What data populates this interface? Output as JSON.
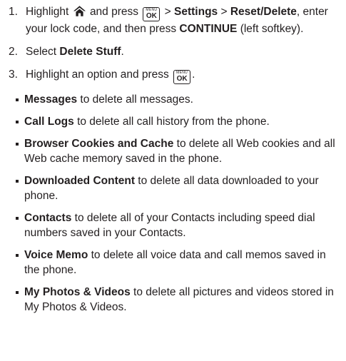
{
  "steps": [
    {
      "num": "1.",
      "p1": "Highlight",
      "p2": "and press",
      "p3": ">",
      "settings": "Settings",
      "p4": ">",
      "reset": "Reset/Delete",
      "p5": ", enter your lock code, and then press",
      "cont": "CONTINUE",
      "p6": "(left softkey)."
    },
    {
      "num": "2.",
      "p1": "Select",
      "bold": "Delete Stuff",
      "p2": "."
    },
    {
      "num": "3.",
      "p1": "Highlight an option and press",
      "p2": "."
    }
  ],
  "icons": {
    "home": "home-icon",
    "menuok_top": "MENU",
    "menuok_bottom": "OK"
  },
  "options": [
    {
      "bold": "Messages",
      "text": " to delete all messages."
    },
    {
      "bold": "Call Logs",
      "text": " to delete all call history from the phone."
    },
    {
      "bold": "Browser Cookies and Cache",
      "text": " to delete all Web cookies and all Web cache memory saved in the phone."
    },
    {
      "bold": "Downloaded Content",
      "text": " to delete all data downloaded to your phone."
    },
    {
      "bold": "Contacts",
      "text": " to delete all of your Contacts including speed dial numbers saved in your Contacts."
    },
    {
      "bold": "Voice Memo",
      "text": " to delete all voice data and call memos saved in the phone."
    },
    {
      "bold": "My Photos & Videos",
      "text": " to delete all pictures and videos stored in My Photos & Videos."
    }
  ]
}
